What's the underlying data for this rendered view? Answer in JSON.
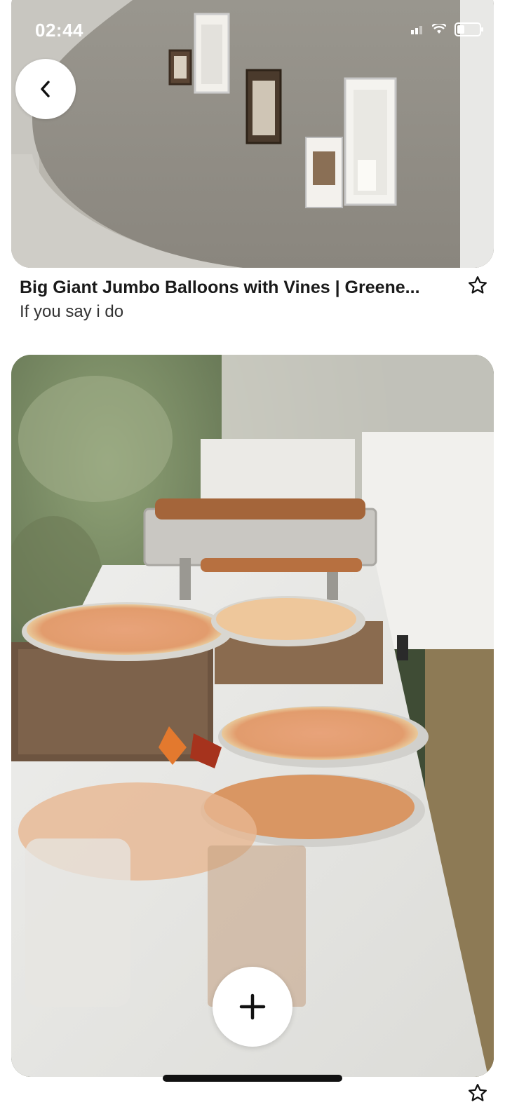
{
  "status_bar": {
    "time": "02:44"
  },
  "pins": [
    {
      "title": "Big Giant Jumbo Balloons with Vines | Greene...",
      "subtitle": "If you say i do"
    }
  ],
  "icons": {
    "back": "chevron-left-icon",
    "save": "star-outline-icon",
    "add": "plus-icon"
  }
}
